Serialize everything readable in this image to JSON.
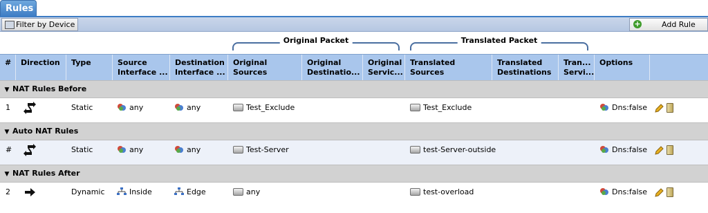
{
  "tab": {
    "label": "Rules"
  },
  "toolbar": {
    "filter_label": "Filter by Device",
    "add_label": "Add Rule"
  },
  "groups": {
    "original": "Original Packet",
    "translated": "Translated Packet"
  },
  "columns": [
    "#",
    "Direction",
    "Type",
    "Source\nInterface ...",
    "Destination\nInterface ...",
    "Original\nSources",
    "Original\nDestinatio...",
    "Original\nServic...",
    "Translated\nSources",
    "Translated\nDestinations",
    "Tran...\nServi...",
    "Options"
  ],
  "sections": [
    {
      "title": "NAT Rules Before"
    },
    {
      "title": "Auto NAT Rules"
    },
    {
      "title": "NAT Rules After"
    }
  ],
  "rows": [
    {
      "num": "1",
      "direction": "two-way-arrows-icon",
      "type": "Static",
      "src_if": "any",
      "src_if_icon": "network-zone-icon",
      "dst_if": "any",
      "dst_if_icon": "network-zone-icon",
      "orig_src": "Test_Exclude",
      "trans_src": "Test_Exclude",
      "options": "Dns:false"
    },
    {
      "num": "#",
      "direction": "two-way-arrows-icon",
      "type": "Static",
      "src_if": "any",
      "src_if_icon": "network-zone-icon",
      "dst_if": "any",
      "dst_if_icon": "network-zone-icon",
      "orig_src": "Test-Server",
      "trans_src": "test-Server-outside",
      "options": "Dns:false"
    },
    {
      "num": "2",
      "direction": "one-way-arrow-icon",
      "type": "Dynamic",
      "src_if": "Inside",
      "src_if_icon": "interface-icon",
      "dst_if": "Edge",
      "dst_if_icon": "interface-icon",
      "orig_src": "any",
      "trans_src": "test-overload",
      "options": "Dns:false"
    }
  ],
  "colors": {
    "header": "#a9c6ec",
    "tab": "#3d7cc4",
    "section": "#d2d2d2",
    "alt_row": "#edf1f9"
  }
}
